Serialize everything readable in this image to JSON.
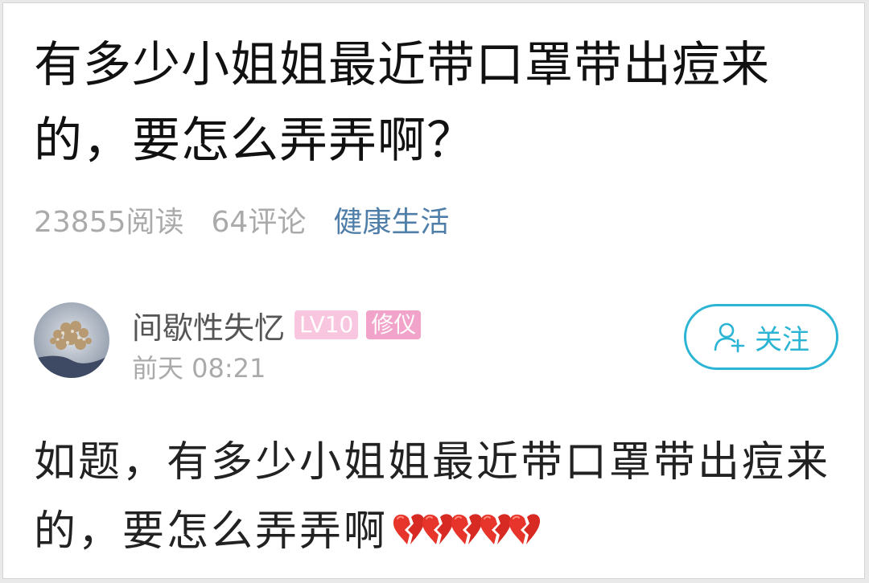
{
  "post": {
    "title": "有多少小姐姐最近带口罩带出痘来的，要怎么弄弄啊？",
    "reads": "23855阅读",
    "comments": "64评论",
    "topic": "健康生活",
    "body": "如题，有多少小姐姐最近带口罩带出痘来的，要怎么弄弄啊"
  },
  "author": {
    "name": "间歇性失忆",
    "level_badge": "LV10",
    "rank_badge": "修仪",
    "time": "前天 08:21"
  },
  "follow": {
    "label": "关注",
    "icon": "add-user-icon"
  },
  "emoji": {
    "icon": "broken-heart-icon",
    "count": 5
  },
  "colors": {
    "accent": "#2bb4d4",
    "topic": "#4f7ea9",
    "level_badge": "#f8c6de",
    "rank_badge": "#f2a3c9",
    "muted": "#aaaaaa"
  }
}
